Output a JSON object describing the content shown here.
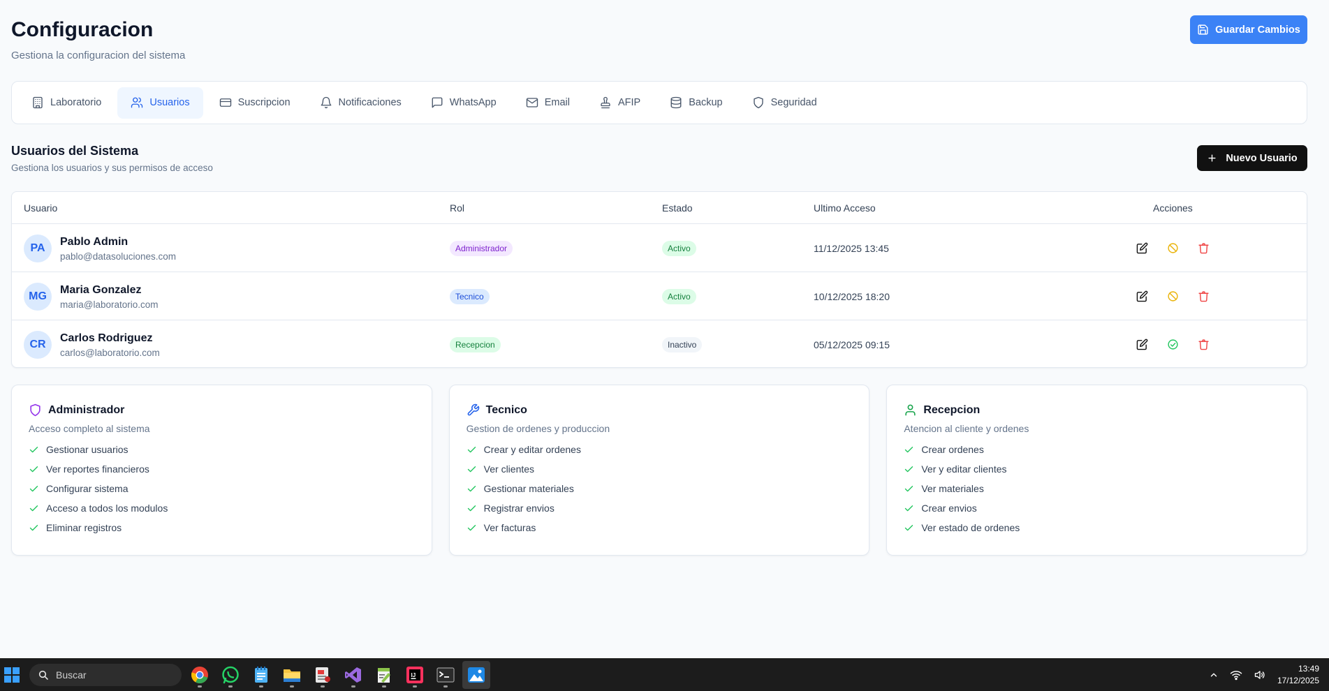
{
  "header": {
    "title": "Configuracion",
    "subtitle": "Gestiona la configuracion del sistema",
    "save_label": "Guardar Cambios"
  },
  "tabs": [
    {
      "label": "Laboratorio",
      "icon": "building-icon"
    },
    {
      "label": "Usuarios",
      "icon": "users-icon",
      "active": true
    },
    {
      "label": "Suscripcion",
      "icon": "credit-card-icon"
    },
    {
      "label": "Notificaciones",
      "icon": "bell-icon"
    },
    {
      "label": "WhatsApp",
      "icon": "message-icon"
    },
    {
      "label": "Email",
      "icon": "mail-icon"
    },
    {
      "label": "AFIP",
      "icon": "stamp-icon"
    },
    {
      "label": "Backup",
      "icon": "database-icon"
    },
    {
      "label": "Seguridad",
      "icon": "shield-icon"
    }
  ],
  "users_section": {
    "title": "Usuarios del Sistema",
    "subtitle": "Gestiona los usuarios y sus permisos de acceso",
    "new_label": "Nuevo Usuario"
  },
  "table": {
    "columns": [
      "Usuario",
      "Rol",
      "Estado",
      "Ultimo Acceso",
      "Acciones"
    ],
    "rows": [
      {
        "initials": "PA",
        "name": "Pablo Admin",
        "email": "pablo@datasoluciones.com",
        "role": "Administrador",
        "status": "Activo",
        "last_access": "11/12/2025 13:45"
      },
      {
        "initials": "MG",
        "name": "Maria Gonzalez",
        "email": "maria@laboratorio.com",
        "role": "Tecnico",
        "status": "Activo",
        "last_access": "10/12/2025 18:20"
      },
      {
        "initials": "CR",
        "name": "Carlos Rodriguez",
        "email": "carlos@laboratorio.com",
        "role": "Recepcion",
        "status": "Inactivo",
        "last_access": "05/12/2025 09:15"
      }
    ]
  },
  "roles": [
    {
      "title": "Administrador",
      "description": "Acceso completo al sistema",
      "permissions": [
        "Gestionar usuarios",
        "Ver reportes financieros",
        "Configurar sistema",
        "Acceso a todos los modulos",
        "Eliminar registros"
      ]
    },
    {
      "title": "Tecnico",
      "description": "Gestion de ordenes y produccion",
      "permissions": [
        "Crear y editar ordenes",
        "Ver clientes",
        "Gestionar materiales",
        "Registrar envios",
        "Ver facturas"
      ]
    },
    {
      "title": "Recepcion",
      "description": "Atencion al cliente y ordenes",
      "permissions": [
        "Crear ordenes",
        "Ver y editar clientes",
        "Ver materiales",
        "Crear envios",
        "Ver estado de ordenes"
      ]
    }
  ],
  "colors": {
    "primary": "#3b82f6",
    "admin_badge_bg": "#f3e8ff",
    "admin_badge_fg": "#7e22ce",
    "tecnico_badge_bg": "#dbeafe",
    "tecnico_badge_fg": "#1d4ed8",
    "recepcion_badge_bg": "#dcfce7",
    "recepcion_badge_fg": "#15803d",
    "active_bg": "#dcfce7",
    "active_fg": "#15803d",
    "inactive_bg": "#f1f5f9",
    "inactive_fg": "#334155",
    "warn": "#eab308",
    "danger": "#ef4444",
    "success": "#22c55e"
  },
  "taskbar": {
    "search_placeholder": "Buscar",
    "time": "13:49",
    "date": "17/12/2025"
  }
}
